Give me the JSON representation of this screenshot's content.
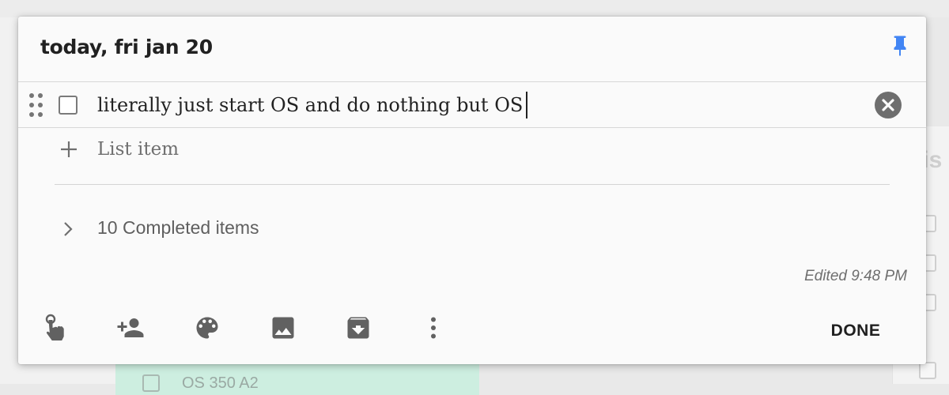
{
  "background": {
    "right_partial_text": "his",
    "green_card_text": "OS 350 A2"
  },
  "note": {
    "title": "today, fri jan 20",
    "pin_icon": "pin-icon",
    "items": [
      {
        "text": "literally just start OS and do nothing but OS",
        "checked": false
      }
    ],
    "add_item_placeholder": "List item",
    "completed_label": "10 Completed items",
    "edited_label": "Edited 9:48 PM"
  },
  "toolbar": {
    "icons": [
      "remind-me-icon",
      "collaborator-icon",
      "palette-icon",
      "image-icon",
      "archive-icon",
      "more-icon"
    ],
    "done_label": "DONE"
  },
  "colors": {
    "pin_accent": "#4285f4",
    "dialog_bg": "#fafafa",
    "icon_gray": "#616161"
  }
}
